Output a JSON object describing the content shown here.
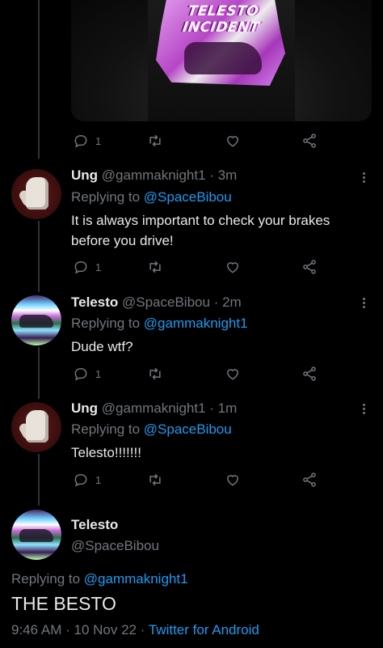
{
  "media": {
    "print_title": "TELESTO INCIDENT"
  },
  "media_actions": {
    "reply_count": "1"
  },
  "replies": [
    {
      "name": "Ung",
      "handle": "@gammaknight1",
      "time": "· 3m",
      "replying_prefix": "Replying to ",
      "replying_to": "@SpaceBibou",
      "text": "It is always important to check your brakes before you drive!",
      "reply_count": "1",
      "avatar_icon": "raised-fist-avatar"
    },
    {
      "name": "Telesto",
      "handle": "@SpaceBibou",
      "time": "· 2m",
      "replying_prefix": "Replying to ",
      "replying_to": "@gammaknight1",
      "text": "Dude wtf?",
      "reply_count": "1",
      "avatar_icon": "glitch-car-avatar"
    },
    {
      "name": "Ung",
      "handle": "@gammaknight1",
      "time": "· 1m",
      "replying_prefix": "Replying to ",
      "replying_to": "@SpaceBibou",
      "text": "Telesto!!!!!!!",
      "reply_count": "1",
      "avatar_icon": "raised-fist-avatar"
    }
  ],
  "main_tweet": {
    "name": "Telesto",
    "handle": "@SpaceBibou",
    "replying_prefix": "Replying to ",
    "replying_to": "@gammaknight1",
    "text": "THE BESTO",
    "time": "9:46 AM",
    "date": "10 Nov 22",
    "source": "Twitter for Android",
    "separator": "·"
  },
  "colors": {
    "background": "#000000",
    "text": "#e7e9ea",
    "secondary": "#71767b",
    "accent": "#1d9bf0"
  }
}
